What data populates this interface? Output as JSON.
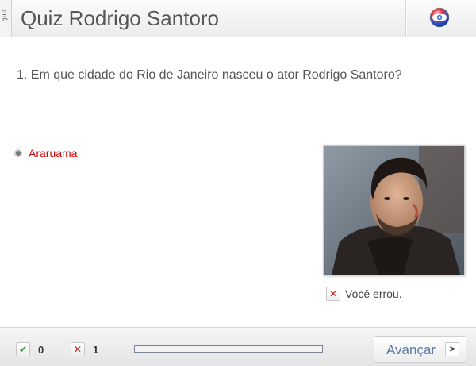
{
  "header": {
    "side_tab": "QUIZ",
    "title": "Quiz Rodrigo Santoro",
    "logo_icon": "globo-logo-icon"
  },
  "question": {
    "text": "1. Em que cidade do Rio de Janeiro nasceu o ator Rodrigo Santoro?"
  },
  "options": [
    {
      "label": "Araruama",
      "selected": true,
      "color": "#d40000"
    }
  ],
  "photo": {
    "icon": "actor-portrait-photo"
  },
  "feedback": {
    "icon": "x-icon",
    "text": "Você errou."
  },
  "footer": {
    "correct_count": "0",
    "wrong_count": "1",
    "progress_fraction": 0,
    "next_label": "Avançar",
    "next_icon": "chevron-right-icon"
  },
  "colors": {
    "accent": "#5878a8",
    "wrong": "#c62020",
    "correct": "#2e9a2e"
  }
}
